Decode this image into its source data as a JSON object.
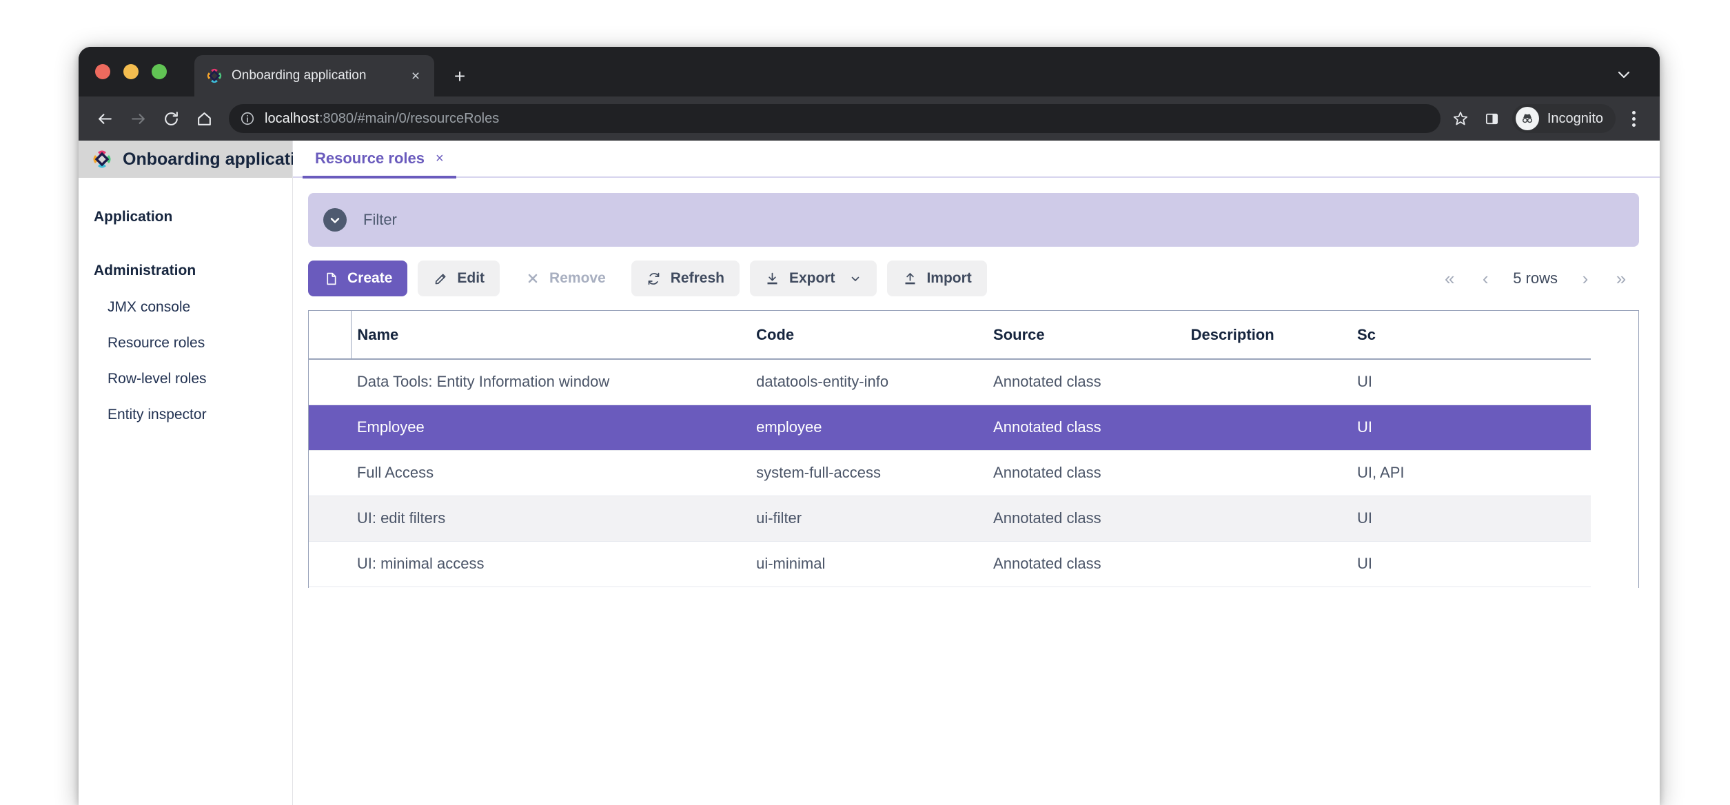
{
  "browser": {
    "tab": {
      "title": "Onboarding application",
      "favicon": "app-logo-icon",
      "close": "×"
    },
    "new_tab": "+",
    "nav": {
      "back": "←",
      "forward": "→",
      "reload": "⟳",
      "home": "⌂"
    },
    "omnibox": {
      "host": "localhost",
      "path": ":8080/#main/0/resourceRoles",
      "site_info_icon": "info-icon"
    },
    "bookmark_icon": "star-icon",
    "side_panel_icon": "side-panel-icon",
    "profile": {
      "label": "Incognito",
      "icon": "incognito-icon"
    },
    "menu_icon": "three-dots-icon"
  },
  "sidebar": {
    "app_title": "Onboarding application",
    "logo": "app-logo-icon",
    "sections": [
      {
        "label": "Application",
        "items": []
      },
      {
        "label": "Administration",
        "items": [
          {
            "label": "JMX console"
          },
          {
            "label": "Resource roles"
          },
          {
            "label": "Row-level roles"
          },
          {
            "label": "Entity inspector"
          }
        ]
      }
    ]
  },
  "app_tabs": [
    {
      "label": "Resource roles",
      "close": "×",
      "active": true
    }
  ],
  "filter": {
    "label": "Filter",
    "icon": "chevron-down-circle-icon",
    "expanded": false
  },
  "toolbar": {
    "create": {
      "label": "Create",
      "icon": "file-icon"
    },
    "edit": {
      "label": "Edit",
      "icon": "pencil-icon"
    },
    "remove": {
      "label": "Remove",
      "icon": "times-icon",
      "disabled": true
    },
    "refresh": {
      "label": "Refresh",
      "icon": "refresh-icon"
    },
    "export": {
      "label": "Export",
      "icon": "download-icon",
      "caret": "⌄"
    },
    "import": {
      "label": "Import",
      "icon": "upload-icon"
    }
  },
  "pager": {
    "first": "«",
    "prev": "‹",
    "count": "5 rows",
    "next": "›",
    "last": "»"
  },
  "table": {
    "columns": [
      "Name",
      "Code",
      "Source",
      "Description",
      "Sc"
    ],
    "rows": [
      {
        "name": "Data Tools: Entity Information window",
        "code": "datatools-entity-info",
        "source": "Annotated class",
        "description": "",
        "scopes": "UI",
        "selected": false,
        "zebra": false
      },
      {
        "name": "Employee",
        "code": "employee",
        "source": "Annotated class",
        "description": "",
        "scopes": "UI",
        "selected": true,
        "zebra": false
      },
      {
        "name": "Full Access",
        "code": "system-full-access",
        "source": "Annotated class",
        "description": "",
        "scopes": "UI, API",
        "selected": false,
        "zebra": false
      },
      {
        "name": "UI: edit filters",
        "code": "ui-filter",
        "source": "Annotated class",
        "description": "",
        "scopes": "UI",
        "selected": false,
        "zebra": true
      },
      {
        "name": "UI: minimal access",
        "code": "ui-minimal",
        "source": "Annotated class",
        "description": "",
        "scopes": "UI",
        "selected": false,
        "zebra": false
      }
    ]
  },
  "colors": {
    "accent": "#6a5bbd",
    "filter_bar": "#cfcbe8",
    "selected_row": "#6a5bbd",
    "zebra_row": "#f2f2f4",
    "sidebar_header": "#d6d6d6",
    "text_dark": "#16253e",
    "browser_chrome": "#202124",
    "browser_toolbar": "#35363a"
  }
}
